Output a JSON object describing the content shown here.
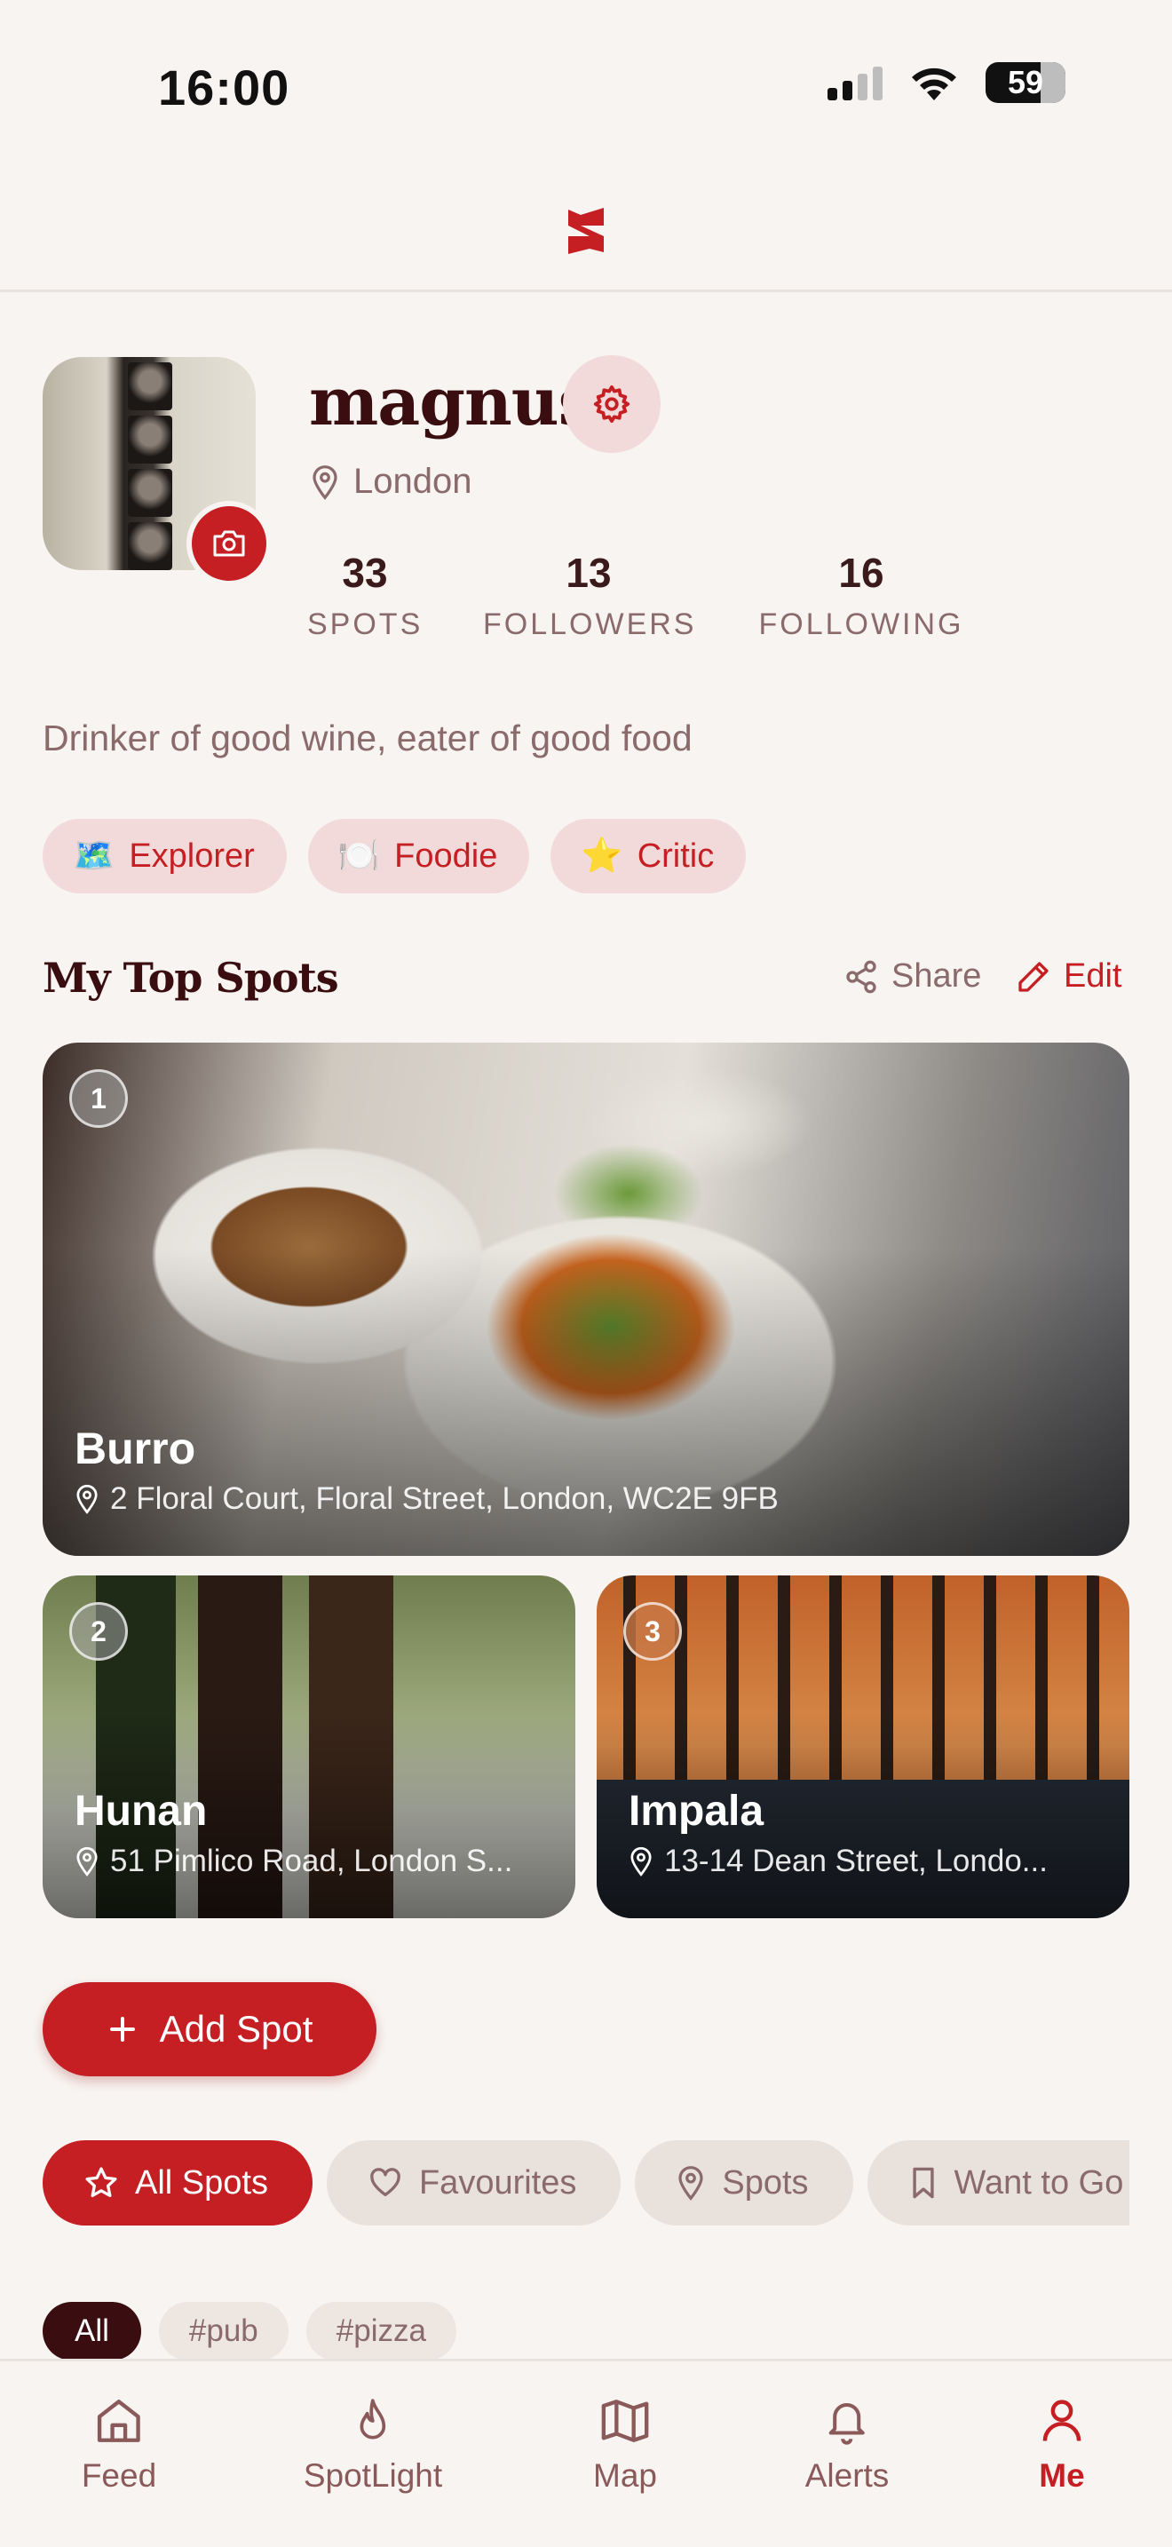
{
  "status_bar": {
    "time": "16:00",
    "battery": "59"
  },
  "header": {
    "logo": "s-logo-icon"
  },
  "profile": {
    "username": "magnus",
    "location": "London",
    "stats": [
      {
        "value": "33",
        "label": "SPOTS"
      },
      {
        "value": "13",
        "label": "FOLLOWERS"
      },
      {
        "value": "16",
        "label": "FOLLOWING"
      }
    ],
    "bio": "Drinker of good wine, eater of good food",
    "badges": [
      {
        "emoji": "🗺️",
        "label": "Explorer"
      },
      {
        "emoji": "🍽️",
        "label": "Foodie"
      },
      {
        "emoji": "⭐",
        "label": "Critic"
      }
    ]
  },
  "top_spots": {
    "title": "My Top Spots",
    "share_label": "Share",
    "edit_label": "Edit",
    "spots": [
      {
        "rank": "1",
        "name": "Burro",
        "address": "2 Floral Court, Floral Street, London, WC2E 9FB"
      },
      {
        "rank": "2",
        "name": "Hunan",
        "address": "51 Pimlico Road, London S..."
      },
      {
        "rank": "3",
        "name": "Impala",
        "address": "13-14 Dean Street, Londo..."
      }
    ]
  },
  "add_spot_label": "Add Spot",
  "filters": [
    "All Spots",
    "Favourites",
    "Spots",
    "Want to Go"
  ],
  "tags": [
    "All",
    "#pub",
    "#pizza"
  ],
  "tab_bar": [
    "Feed",
    "SpotLight",
    "Map",
    "Alerts",
    "Me"
  ],
  "colors": {
    "accent": "#C51E23",
    "dark": "#3A0E10",
    "muted": "#8A6A6A",
    "background": "#F7F4F1"
  }
}
